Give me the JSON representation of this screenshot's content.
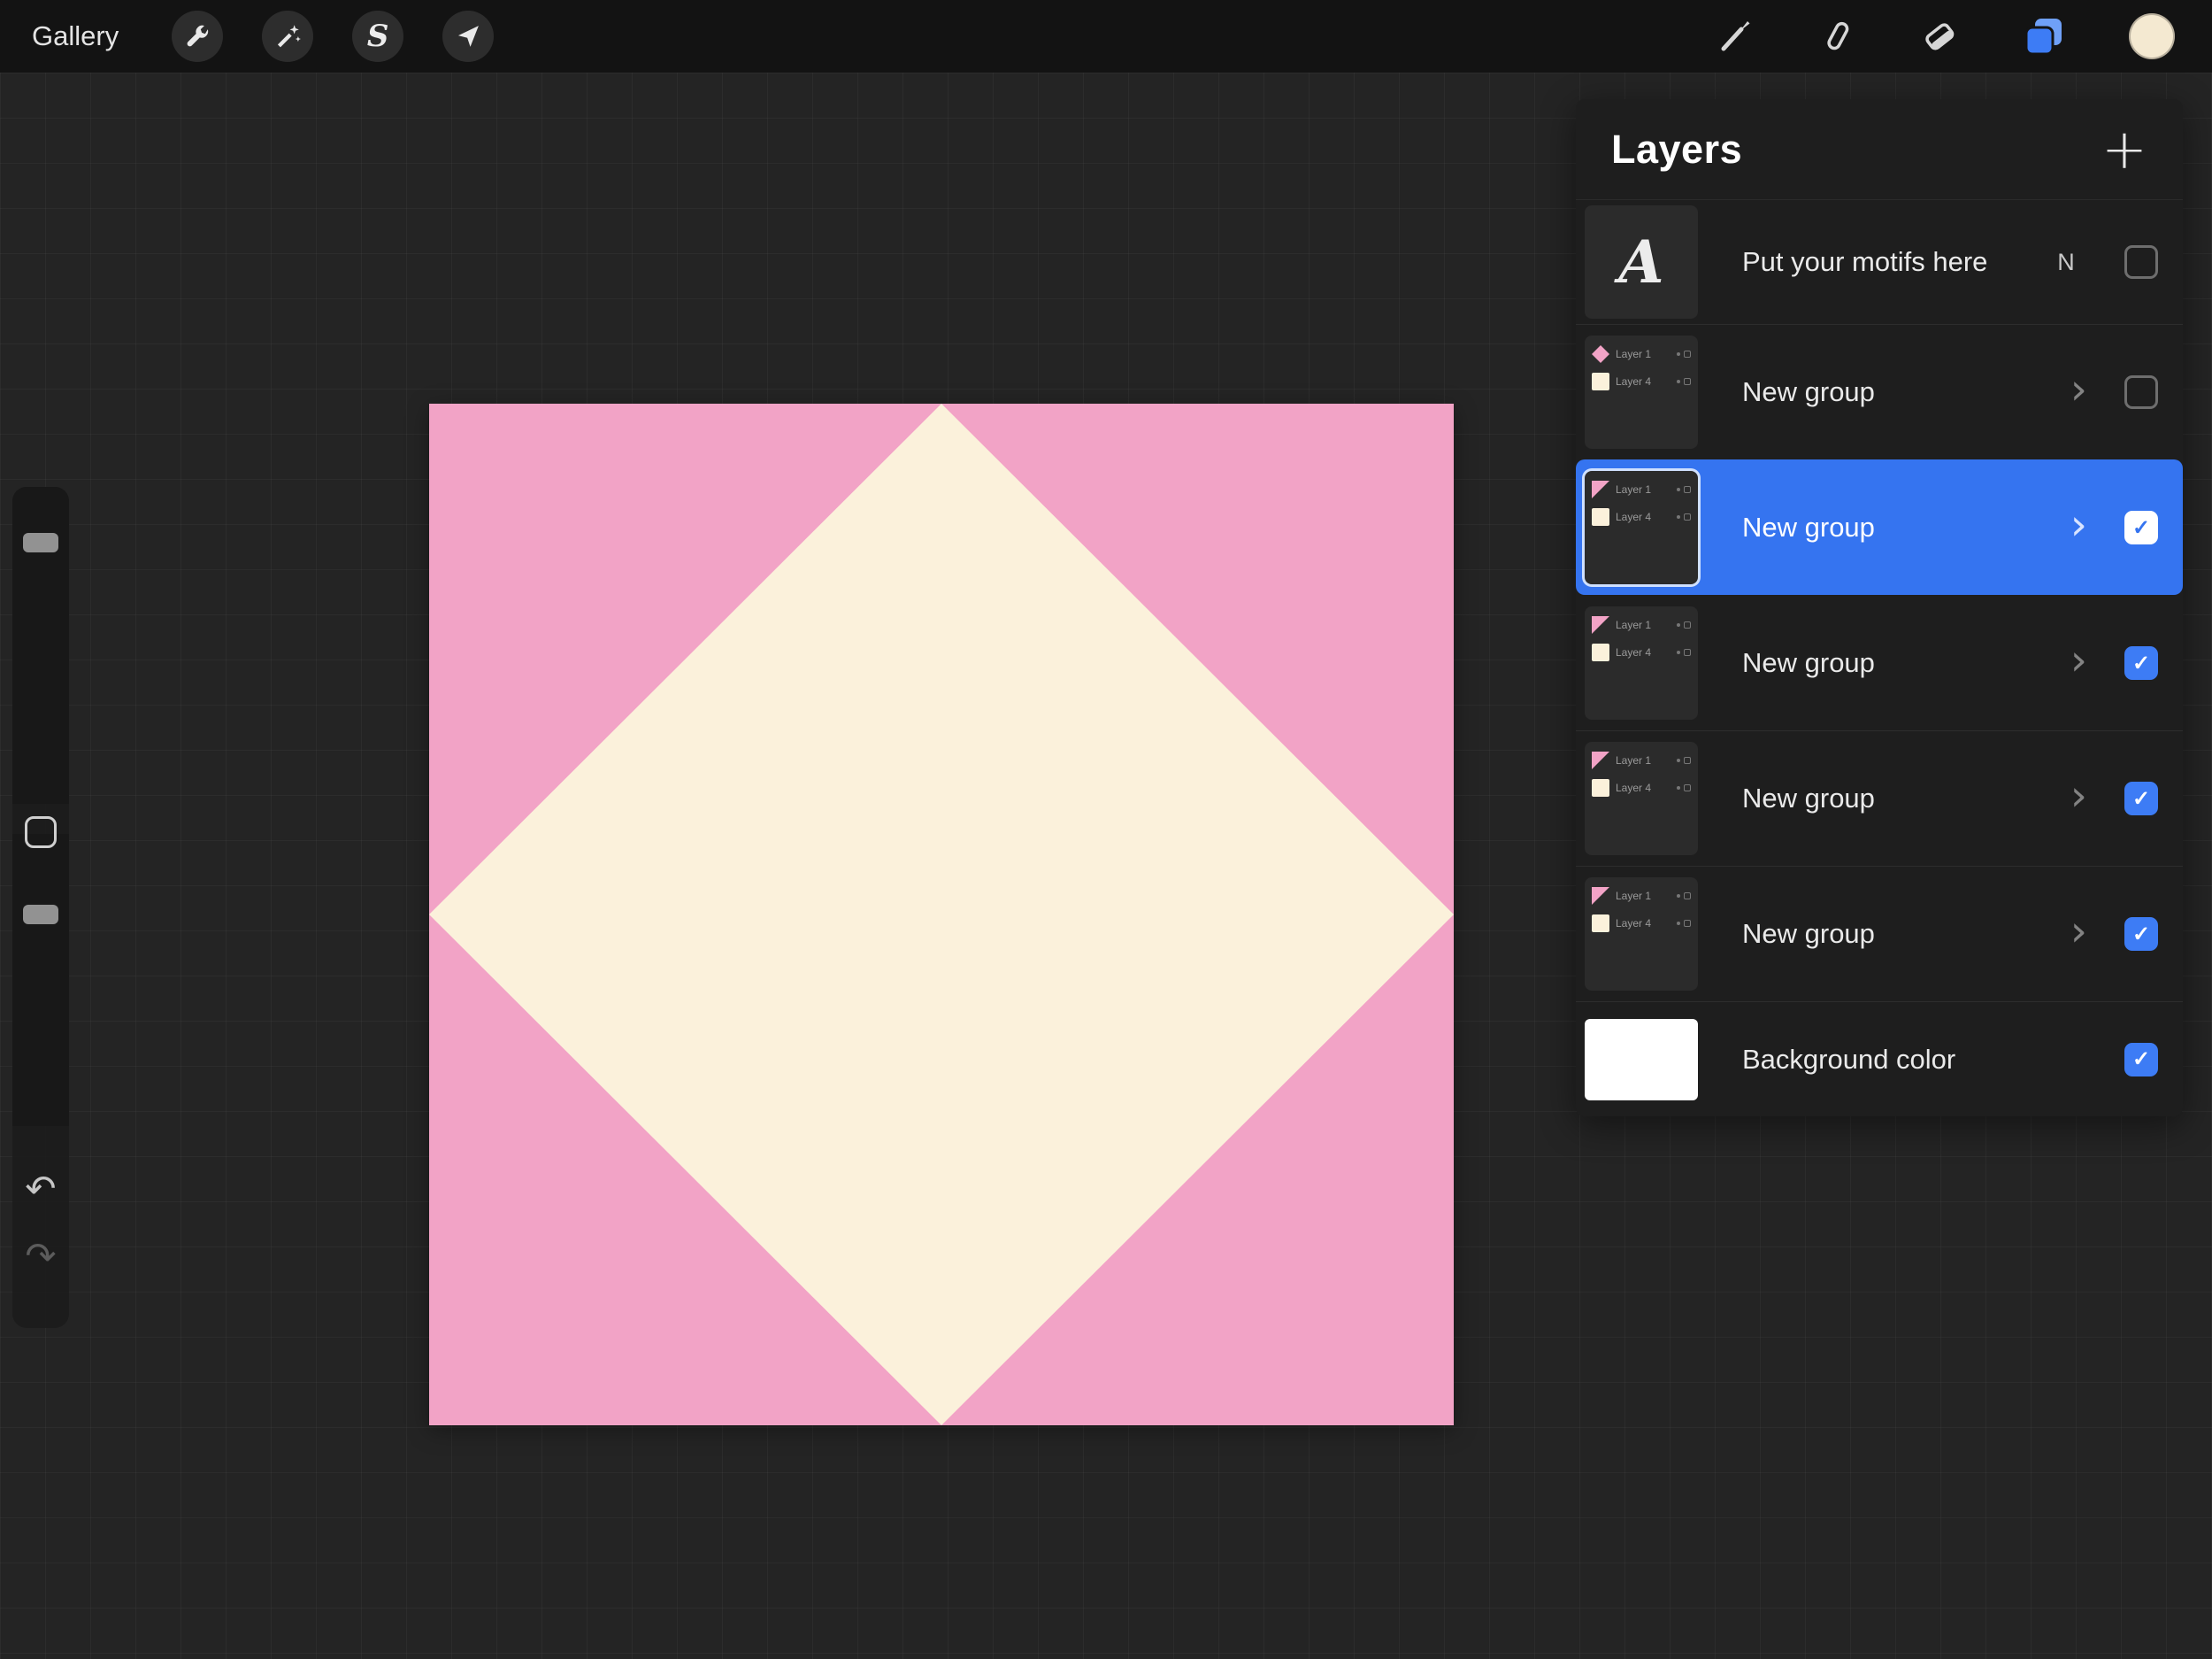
{
  "css_vars": {
    "--pink": "#F2A3C6",
    "--cream": "#FBF1DB",
    "--accent": "#3574F0",
    "--cb-blue": "#3D7CF5",
    "--active-color": "#F4E9D1"
  },
  "topbar": {
    "gallery_label": "Gallery",
    "selection_glyph": "S",
    "left_tools": [
      "actions-wrench",
      "adjustments-wand",
      "selection",
      "transform-arrow"
    ],
    "right_tools": [
      "brush",
      "smudge",
      "eraser",
      "layers",
      "color"
    ],
    "active_color": "#F4E9D1"
  },
  "icons": {
    "plus": "+",
    "check": "✓",
    "chevron": "›",
    "undo": "↶",
    "redo": "↷"
  },
  "canvas": {
    "square_color": "#F2A3C6",
    "diamond_color": "#FBF1DB"
  },
  "layers_panel": {
    "title": "Layers",
    "group_thumb_layers": [
      "Layer 1",
      "Layer 4"
    ],
    "rows": [
      {
        "title": "Put your motifs here",
        "type": "text",
        "blend": "N",
        "checked": false,
        "selected": false
      },
      {
        "title": "New group",
        "type": "group",
        "checked": false,
        "selected": false
      },
      {
        "title": "New group",
        "type": "group",
        "checked": true,
        "selected": true
      },
      {
        "title": "New group",
        "type": "group",
        "checked": true,
        "selected": false
      },
      {
        "title": "New group",
        "type": "group",
        "checked": true,
        "selected": false
      },
      {
        "title": "New group",
        "type": "group",
        "checked": true,
        "selected": false
      },
      {
        "title": "Background color",
        "type": "background",
        "checked": true,
        "selected": false
      }
    ]
  }
}
